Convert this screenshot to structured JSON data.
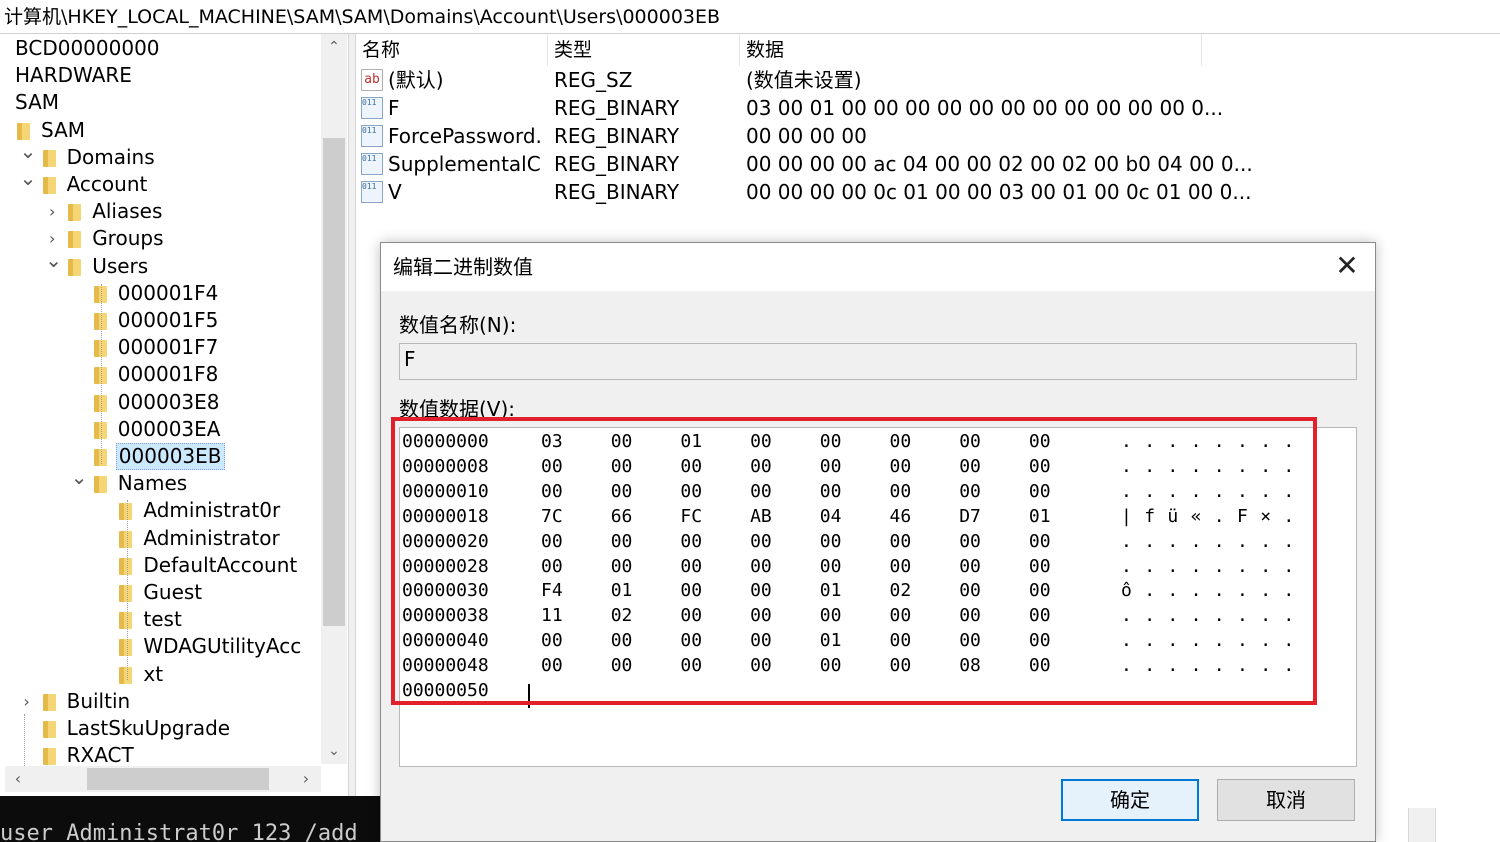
{
  "address": "计算机\\HKEY_LOCAL_MACHINE\\SAM\\SAM\\Domains\\Account\\Users\\000003EB",
  "tree": {
    "items": [
      {
        "label": "BCD00000000",
        "level": -1,
        "expander": "",
        "folder": false
      },
      {
        "label": "HARDWARE",
        "level": -1,
        "expander": "",
        "folder": false
      },
      {
        "label": "SAM",
        "level": -1,
        "expander": "",
        "folder": false
      },
      {
        "label": "SAM",
        "level": 0,
        "expander": "",
        "folder": true
      },
      {
        "label": "Domains",
        "level": 0,
        "expander": "open",
        "folder": true,
        "indentSelf": 1
      },
      {
        "label": "Account",
        "level": 1,
        "expander": "open",
        "folder": true
      },
      {
        "label": "Aliases",
        "level": 2,
        "expander": "closed",
        "folder": true
      },
      {
        "label": "Groups",
        "level": 2,
        "expander": "closed",
        "folder": true
      },
      {
        "label": "Users",
        "level": 2,
        "expander": "open",
        "folder": true
      },
      {
        "label": "000001F4",
        "level": 3,
        "expander": "",
        "folder": true
      },
      {
        "label": "000001F5",
        "level": 3,
        "expander": "",
        "folder": true
      },
      {
        "label": "000001F7",
        "level": 3,
        "expander": "",
        "folder": true
      },
      {
        "label": "000001F8",
        "level": 3,
        "expander": "",
        "folder": true
      },
      {
        "label": "000003E8",
        "level": 3,
        "expander": "",
        "folder": true
      },
      {
        "label": "000003EA",
        "level": 3,
        "expander": "",
        "folder": true
      },
      {
        "label": "000003EB",
        "level": 3,
        "expander": "",
        "folder": true,
        "selected": true
      },
      {
        "label": "Names",
        "level": 3,
        "expander": "open",
        "folder": true
      },
      {
        "label": "Administrat0r",
        "level": 4,
        "expander": "",
        "folder": true
      },
      {
        "label": "Administrator",
        "level": 4,
        "expander": "",
        "folder": true
      },
      {
        "label": "DefaultAccount",
        "level": 4,
        "expander": "",
        "folder": true
      },
      {
        "label": "Guest",
        "level": 4,
        "expander": "",
        "folder": true
      },
      {
        "label": "test",
        "level": 4,
        "expander": "",
        "folder": true
      },
      {
        "label": "WDAGUtilityAcc",
        "level": 4,
        "expander": "",
        "folder": true
      },
      {
        "label": "xt",
        "level": 4,
        "expander": "",
        "folder": true
      },
      {
        "label": "Builtin",
        "level": 1,
        "expander": "closed",
        "folder": true
      },
      {
        "label": "LastSkuUpgrade",
        "level": 0,
        "expander": "",
        "folder": true,
        "indentSelf": 1
      },
      {
        "label": "RXACT",
        "level": 0,
        "expander": "",
        "folder": true,
        "indentSelf": 1
      }
    ]
  },
  "list": {
    "headers": {
      "name": "名称",
      "type": "类型",
      "data": "数据"
    },
    "rows": [
      {
        "icon": "string-value-icon",
        "name": "(默认)",
        "type": "REG_SZ",
        "data": "(数值未设置)"
      },
      {
        "icon": "binary-value-icon",
        "name": "F",
        "type": "REG_BINARY",
        "data": "03 00 01 00 00 00 00 00 00 00 00 00 00 00 0..."
      },
      {
        "icon": "binary-value-icon",
        "name": "ForcePassword...",
        "type": "REG_BINARY",
        "data": "00 00 00 00"
      },
      {
        "icon": "binary-value-icon",
        "name": "SupplementalC...",
        "type": "REG_BINARY",
        "data": "00 00 00 00 ac 04 00 00 02 00 02 00 b0 04 00 0..."
      },
      {
        "icon": "binary-value-icon",
        "name": "V",
        "type": "REG_BINARY",
        "data": "00 00 00 00 0c 01 00 00 03 00 01 00 0c 01 00 0..."
      }
    ]
  },
  "terminal": {
    "text": "user Administrat0r 123 /add"
  },
  "dialog": {
    "title": "编辑二进制数值",
    "close_glyph": "✕",
    "name_label": "数值名称(N):",
    "name_value": "F",
    "data_label": "数值数据(V):",
    "hex_rows": [
      {
        "offset": "00000000",
        "bytes": [
          "03",
          "00",
          "01",
          "00",
          "00",
          "00",
          "00",
          "00"
        ],
        "ascii": [
          ".",
          ".",
          ".",
          ".",
          ".",
          ".",
          ".",
          "."
        ]
      },
      {
        "offset": "00000008",
        "bytes": [
          "00",
          "00",
          "00",
          "00",
          "00",
          "00",
          "00",
          "00"
        ],
        "ascii": [
          ".",
          ".",
          ".",
          ".",
          ".",
          ".",
          ".",
          "."
        ]
      },
      {
        "offset": "00000010",
        "bytes": [
          "00",
          "00",
          "00",
          "00",
          "00",
          "00",
          "00",
          "00"
        ],
        "ascii": [
          ".",
          ".",
          ".",
          ".",
          ".",
          ".",
          ".",
          "."
        ]
      },
      {
        "offset": "00000018",
        "bytes": [
          "7C",
          "66",
          "FC",
          "AB",
          "04",
          "46",
          "D7",
          "01"
        ],
        "ascii": [
          "|",
          "f",
          "ü",
          "«",
          ".",
          "F",
          "×",
          "."
        ]
      },
      {
        "offset": "00000020",
        "bytes": [
          "00",
          "00",
          "00",
          "00",
          "00",
          "00",
          "00",
          "00"
        ],
        "ascii": [
          ".",
          ".",
          ".",
          ".",
          ".",
          ".",
          ".",
          "."
        ]
      },
      {
        "offset": "00000028",
        "bytes": [
          "00",
          "00",
          "00",
          "00",
          "00",
          "00",
          "00",
          "00"
        ],
        "ascii": [
          ".",
          ".",
          ".",
          ".",
          ".",
          ".",
          ".",
          "."
        ]
      },
      {
        "offset": "00000030",
        "bytes": [
          "F4",
          "01",
          "00",
          "00",
          "01",
          "02",
          "00",
          "00"
        ],
        "ascii": [
          "ô",
          ".",
          ".",
          ".",
          ".",
          ".",
          ".",
          "."
        ]
      },
      {
        "offset": "00000038",
        "bytes": [
          "11",
          "02",
          "00",
          "00",
          "00",
          "00",
          "00",
          "00"
        ],
        "ascii": [
          ".",
          ".",
          ".",
          ".",
          ".",
          ".",
          ".",
          "."
        ]
      },
      {
        "offset": "00000040",
        "bytes": [
          "00",
          "00",
          "00",
          "00",
          "01",
          "00",
          "00",
          "00"
        ],
        "ascii": [
          ".",
          ".",
          ".",
          ".",
          ".",
          ".",
          ".",
          "."
        ]
      },
      {
        "offset": "00000048",
        "bytes": [
          "00",
          "00",
          "00",
          "00",
          "00",
          "00",
          "08",
          "00"
        ],
        "ascii": [
          ".",
          ".",
          ".",
          ".",
          ".",
          ".",
          ".",
          "."
        ]
      },
      {
        "offset": "00000050",
        "bytes": [],
        "ascii": []
      }
    ],
    "ok_label": "确定",
    "cancel_label": "取消"
  },
  "colors": {
    "highlight_box": "#e0202a",
    "selection": "#cce8ff",
    "accent": "#0078d7"
  }
}
